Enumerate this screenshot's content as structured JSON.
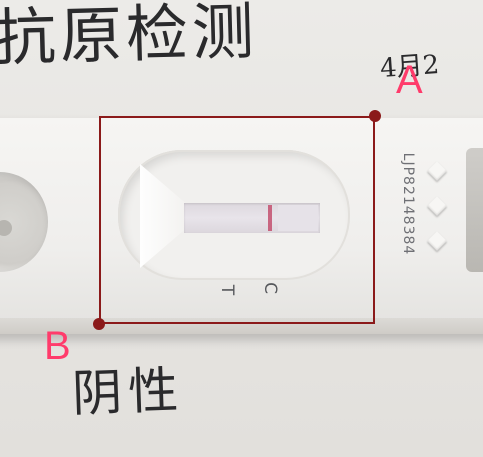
{
  "handwriting": {
    "title": "抗原检测",
    "date": "4月2",
    "result": "阴性"
  },
  "cassette": {
    "lot_number": "LJP82148384",
    "label_c": "C",
    "label_t": "T",
    "control_line_color": "#c3506e"
  },
  "annotations": {
    "box_color": "#8b1a1a",
    "label_color": "#ff3b6b",
    "point_a_label": "A",
    "point_b_label": "B"
  }
}
